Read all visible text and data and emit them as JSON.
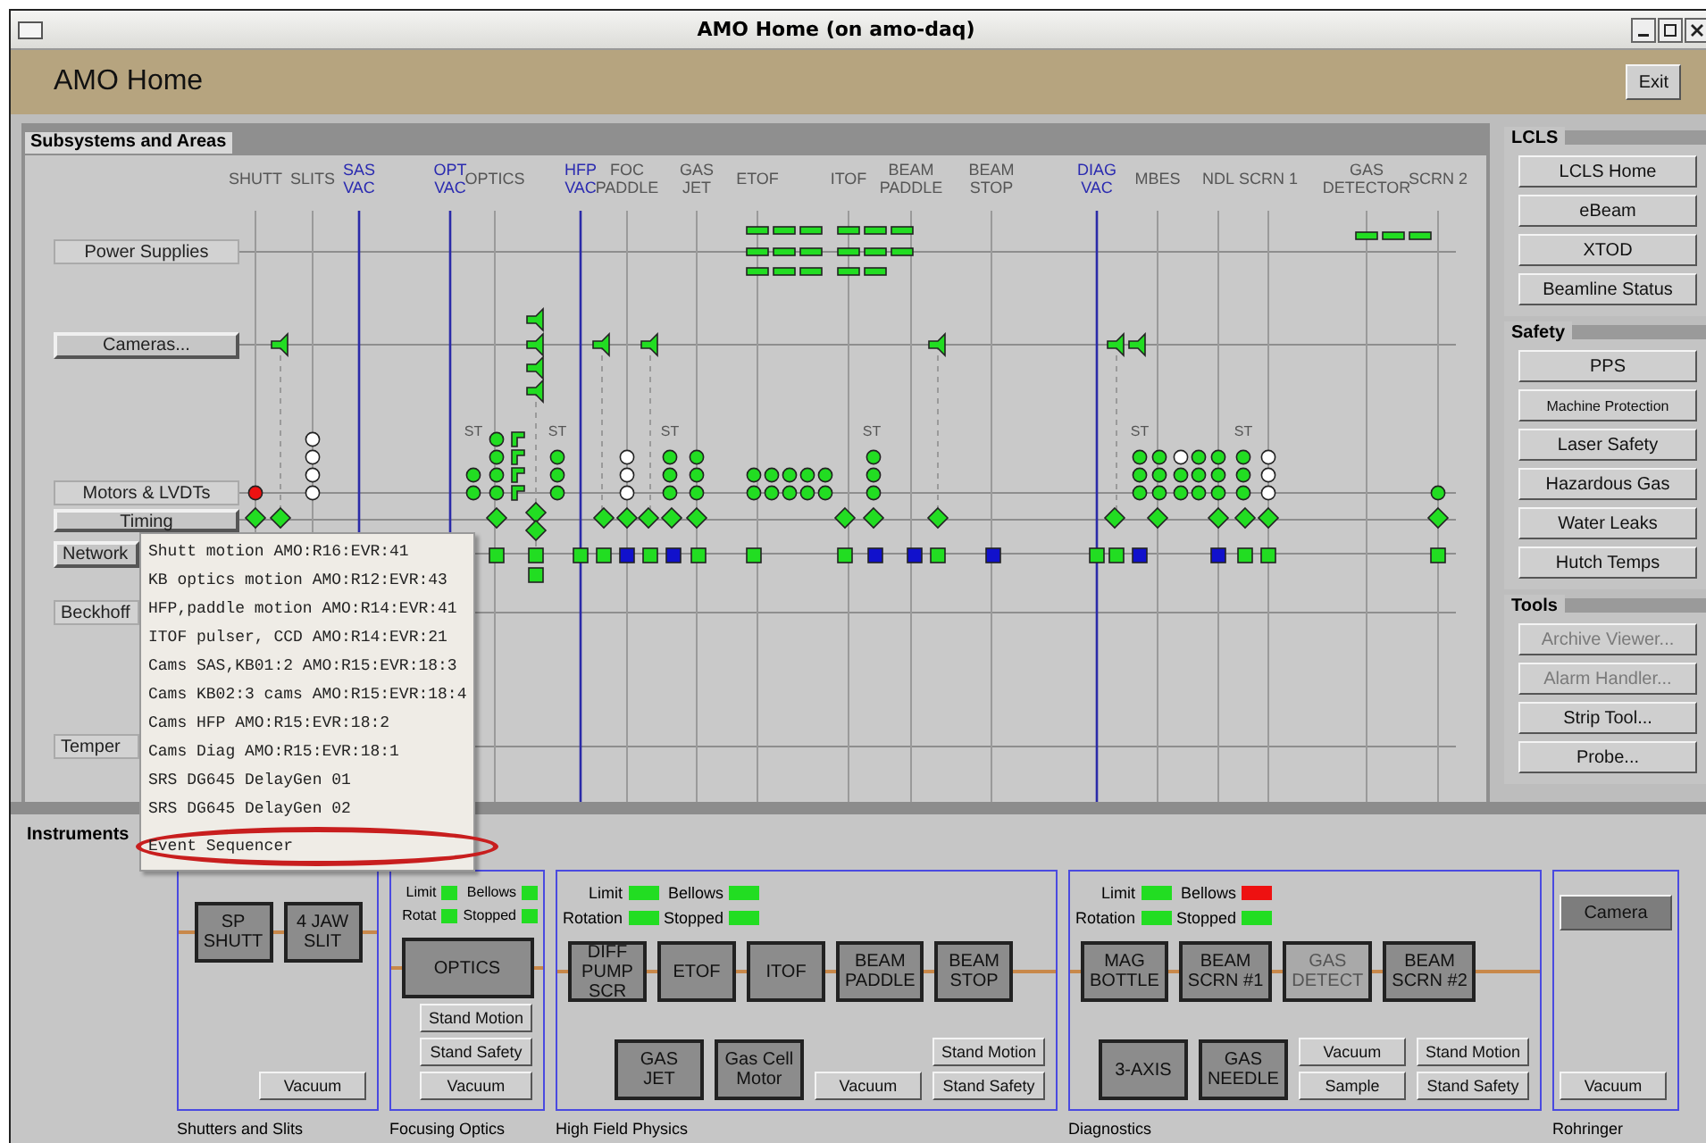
{
  "window": {
    "title": "AMO Home (on amo-daq)"
  },
  "header": {
    "title": "AMO Home",
    "exit": "Exit"
  },
  "subsystems": {
    "title": "Subsystems and Areas",
    "columns": [
      {
        "lines": [
          "SHUTT"
        ],
        "vacuum": false
      },
      {
        "lines": [
          "SLITS"
        ],
        "vacuum": false
      },
      {
        "lines": [
          "SAS",
          "VAC"
        ],
        "vacuum": true
      },
      {
        "lines": [
          "OPT",
          "VAC"
        ],
        "vacuum": true
      },
      {
        "lines": [
          "OPTICS"
        ],
        "vacuum": false
      },
      {
        "lines": [
          "HFP",
          "VAC"
        ],
        "vacuum": true
      },
      {
        "lines": [
          "FOC",
          "PADDLE"
        ],
        "vacuum": false
      },
      {
        "lines": [
          "GAS",
          "JET"
        ],
        "vacuum": false
      },
      {
        "lines": [
          "ETOF"
        ],
        "vacuum": false
      },
      {
        "lines": [
          "ITOF"
        ],
        "vacuum": false
      },
      {
        "lines": [
          "BEAM",
          "PADDLE"
        ],
        "vacuum": false
      },
      {
        "lines": [
          "BEAM",
          "STOP"
        ],
        "vacuum": false
      },
      {
        "lines": [
          "DIAG",
          "VAC"
        ],
        "vacuum": true
      },
      {
        "lines": [
          "MBES"
        ],
        "vacuum": false
      },
      {
        "lines": [
          "NDL"
        ],
        "vacuum": false
      },
      {
        "lines": [
          "SCRN 1"
        ],
        "vacuum": false
      },
      {
        "lines": [
          "GAS",
          "DETECTOR"
        ],
        "vacuum": false
      },
      {
        "lines": [
          "SCRN 2"
        ],
        "vacuum": false
      }
    ],
    "rows": [
      {
        "label": "Power Supplies",
        "kind": "label"
      },
      {
        "label": "Cameras...",
        "kind": "button"
      },
      {
        "label": "Motors & LVDTs",
        "kind": "label"
      },
      {
        "label": "Timing",
        "kind": "button"
      },
      {
        "label": "Network",
        "kind": "button"
      },
      {
        "label": "Beckhoff",
        "kind": "label"
      },
      {
        "label": "Temper",
        "kind": "label"
      }
    ],
    "st_labels": [
      "ST",
      "ST",
      "ST",
      "ST",
      "ST",
      "ST"
    ],
    "markers": [
      {
        "kind": "power",
        "color": "#22dd22"
      },
      {
        "kind": "camera",
        "color": "#22dd22"
      },
      {
        "kind": "motor",
        "color": "#ee1111"
      },
      {
        "kind": "motor",
        "color": "#ffffff"
      },
      {
        "kind": "motor",
        "color": "#22dd22"
      },
      {
        "kind": "encoder",
        "color": "#22dd22"
      },
      {
        "kind": "timing",
        "color": "#22dd22"
      },
      {
        "kind": "network",
        "color": "#22dd22"
      },
      {
        "kind": "network",
        "color": "#1111cc"
      }
    ]
  },
  "timing_menu": [
    {
      "label": "Shutt motion AMO:R16:EVR:41",
      "circled": false
    },
    {
      "label": "KB optics motion AMO:R12:EVR:43",
      "circled": false
    },
    {
      "label": "HFP,paddle motion AMO:R14:EVR:41",
      "circled": false
    },
    {
      "label": "ITOF pulser, CCD AMO:R14:EVR:21",
      "circled": false
    },
    {
      "label": "Cams SAS,KB01:2 AMO:R15:EVR:18:3",
      "circled": false
    },
    {
      "label": "Cams KB02:3 cams AMO:R15:EVR:18:4",
      "circled": false
    },
    {
      "label": "Cams HFP AMO:R15:EVR:18:2",
      "circled": false
    },
    {
      "label": "Cams Diag AMO:R15:EVR:18:1",
      "circled": false
    },
    {
      "label": "SRS DG645 DelayGen 01",
      "circled": false
    },
    {
      "label": "SRS DG645 DelayGen 02",
      "circled": false
    },
    {
      "label": "Event Sequencer",
      "circled": true
    }
  ],
  "side_panels": [
    {
      "title": "LCLS",
      "buttons": [
        {
          "label": "LCLS Home",
          "disabled": false
        },
        {
          "label": "eBeam",
          "disabled": false
        },
        {
          "label": "XTOD",
          "disabled": false
        },
        {
          "label": "Beamline Status",
          "disabled": false
        }
      ]
    },
    {
      "title": "Safety",
      "buttons": [
        {
          "label": "PPS",
          "disabled": false
        },
        {
          "label": "Machine Protection",
          "disabled": false
        },
        {
          "label": "Laser Safety",
          "disabled": false
        },
        {
          "label": "Hazardous Gas",
          "disabled": false
        },
        {
          "label": "Water Leaks",
          "disabled": false
        },
        {
          "label": "Hutch Temps",
          "disabled": false
        }
      ]
    },
    {
      "title": "Tools",
      "buttons": [
        {
          "label": "Archive Viewer...",
          "disabled": true
        },
        {
          "label": "Alarm Handler...",
          "disabled": true
        },
        {
          "label": "Strip Tool...",
          "disabled": false
        },
        {
          "label": "Probe...",
          "disabled": false
        }
      ]
    }
  ],
  "instruments": {
    "title": "Instruments",
    "groups": [
      {
        "name": "Shutters and Slits",
        "devices": [
          {
            "lines": [
              "SP",
              "SHUTT"
            ],
            "disabled": false
          },
          {
            "lines": [
              "4 JAW",
              "SLIT"
            ],
            "disabled": false
          }
        ],
        "button_columns": [
          [
            "Vacuum"
          ]
        ]
      },
      {
        "name": "Focusing Optics",
        "status": [
          {
            "label": "Limit",
            "color": "#22dd22"
          },
          {
            "label": "Bellows",
            "color": "#22dd22"
          },
          {
            "label": "Rotat",
            "color": "#22dd22"
          },
          {
            "label": "Stopped",
            "color": "#22dd22"
          }
        ],
        "devices": [
          {
            "lines": [
              "OPTICS"
            ],
            "disabled": false
          }
        ],
        "button_columns": [
          [
            "Stand Motion",
            "Stand Safety",
            "Vacuum"
          ]
        ]
      },
      {
        "name": "High Field Physics",
        "status": [
          {
            "label": "Limit",
            "color": "#22dd22"
          },
          {
            "label": "Bellows",
            "color": "#22dd22"
          },
          {
            "label": "Rotation",
            "color": "#22dd22"
          },
          {
            "label": "Stopped",
            "color": "#22dd22"
          }
        ],
        "devices": [
          {
            "lines": [
              "DIFF",
              "PUMP",
              "SCR"
            ],
            "disabled": false
          },
          {
            "lines": [
              "ETOF"
            ],
            "disabled": false
          },
          {
            "lines": [
              "ITOF"
            ],
            "disabled": false
          },
          {
            "lines": [
              "BEAM",
              "PADDLE"
            ],
            "disabled": false
          },
          {
            "lines": [
              "BEAM",
              "STOP"
            ],
            "disabled": false
          }
        ],
        "lower_devices": [
          {
            "lines": [
              "GAS",
              "JET"
            ],
            "disabled": false
          },
          {
            "lines": [
              "Gas Cell",
              "Motor"
            ],
            "disabled": false
          }
        ],
        "button_columns": [
          [
            "Vacuum"
          ],
          [
            "Stand Motion",
            "Stand Safety"
          ]
        ]
      },
      {
        "name": "Diagnostics",
        "status": [
          {
            "label": "Limit",
            "color": "#22dd22"
          },
          {
            "label": "Bellows",
            "color": "#ee1111"
          },
          {
            "label": "Rotation",
            "color": "#22dd22"
          },
          {
            "label": "Stopped",
            "color": "#22dd22"
          }
        ],
        "devices": [
          {
            "lines": [
              "MAG",
              "BOTTLE"
            ],
            "disabled": false
          },
          {
            "lines": [
              "BEAM",
              "SCRN #1"
            ],
            "disabled": false
          },
          {
            "lines": [
              "GAS",
              "DETECT"
            ],
            "disabled": true
          },
          {
            "lines": [
              "BEAM",
              "SCRN #2"
            ],
            "disabled": false
          }
        ],
        "lower_devices": [
          {
            "lines": [
              "3-AXIS"
            ],
            "disabled": false
          },
          {
            "lines": [
              "GAS",
              "NEEDLE"
            ],
            "disabled": false
          }
        ],
        "button_columns": [
          [
            "Vacuum",
            "Sample"
          ],
          [
            "Stand Motion",
            "Stand Safety"
          ]
        ]
      },
      {
        "name": "Rohringer",
        "top_buttons": [
          "Camera"
        ],
        "button_columns": [
          [
            "Vacuum"
          ]
        ]
      }
    ]
  }
}
